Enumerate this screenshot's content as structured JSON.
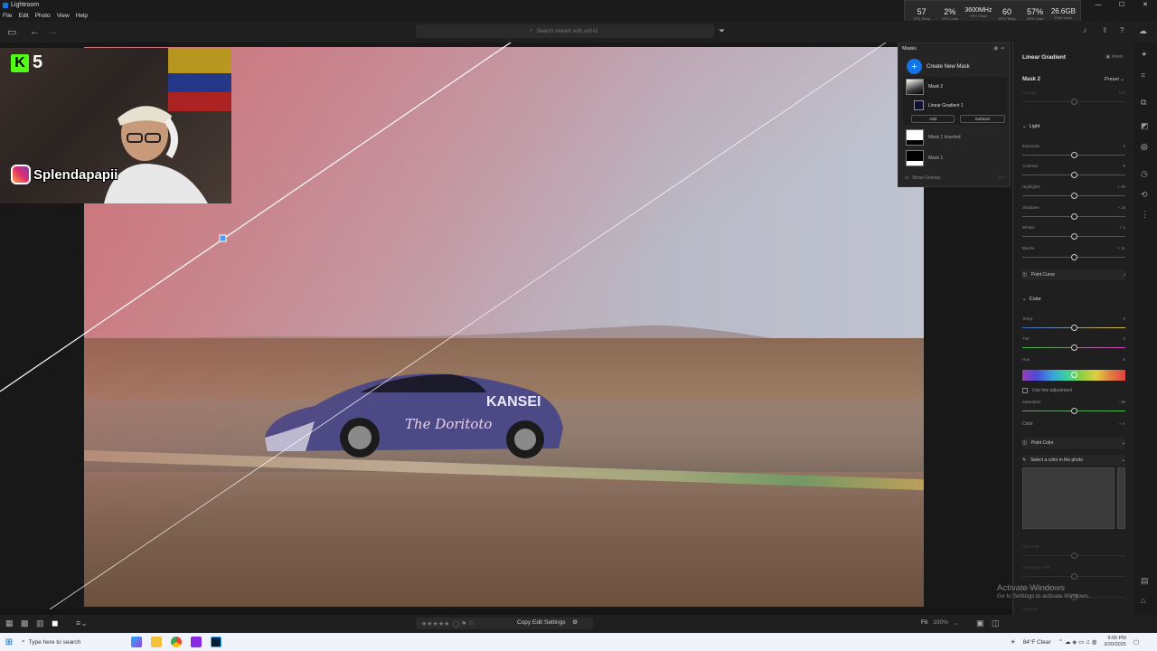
{
  "window": {
    "title": "Lightroom",
    "controls": [
      "—",
      "☐",
      "✕"
    ]
  },
  "menu": [
    "File",
    "Edit",
    "Photo",
    "View",
    "Help"
  ],
  "perf_overlay": [
    {
      "value": "57",
      "label": "CPU Temp"
    },
    {
      "value": "2%",
      "label": "CPU Load"
    },
    {
      "value": "3600MHz",
      "label": "CPU Clock"
    },
    {
      "value": "60",
      "label": "GPU Temp"
    },
    {
      "value": "57%",
      "label": "GPU Load"
    },
    {
      "value": "26.6GB",
      "label": "RAM Used"
    }
  ],
  "search": {
    "placeholder": "Search stream edit.ush#1"
  },
  "webcam": {
    "k_count": "5",
    "instagram": "Splendapapii"
  },
  "masks": {
    "title": "Masks",
    "create_label": "Create New Mask",
    "items": [
      {
        "name": "Mask 2"
      },
      {
        "name": "Linear Gradient 1"
      },
      {
        "name": "Mask 1 Inverted"
      },
      {
        "name": "Mask 1"
      }
    ],
    "add_label": "Add",
    "subtract_label": "Subtract",
    "show_overlay_label": "Show Overlay"
  },
  "right_panel": {
    "title": "Linear Gradient",
    "invert_label": "Invert",
    "mask_name": "Mask 2",
    "preset_label": "Preset",
    "amount_label": "Amount",
    "amount_value": "100",
    "light_section": "Light",
    "light_sliders": [
      {
        "label": "Exposure",
        "value": "0",
        "pos": 0.5
      },
      {
        "label": "Contrast",
        "value": "0",
        "pos": 0.5
      },
      {
        "label": "Highlights",
        "value": "+ 25",
        "pos": 0.5
      },
      {
        "label": "Shadows",
        "value": "+ 16",
        "pos": 0.5
      },
      {
        "label": "Whites",
        "value": "+ 1",
        "pos": 0.5
      },
      {
        "label": "Blacks",
        "value": "+ 11",
        "pos": 0.5
      }
    ],
    "point_curve_label": "Point Curve",
    "color_section": "Color",
    "color_sliders": [
      {
        "label": "Temp",
        "value": "0",
        "pos": 0.5
      },
      {
        "label": "Tint",
        "value": "0",
        "pos": 0.5
      },
      {
        "label": "Hue",
        "value": "0"
      }
    ],
    "fine_adjust_label": "Use fine adjustment",
    "saturation_label": "Saturation",
    "saturation_value": "- 49",
    "color_label": "Color",
    "point_color_label": "Point Color",
    "select_color_label": "Select a color in the photo",
    "faded_sliders": [
      "Hue Shift",
      "Saturation Shift",
      "Luminance Shift",
      "Variance"
    ]
  },
  "activate_windows": {
    "title": "Activate Windows",
    "subtitle": "Go to Settings to activate Windows."
  },
  "bottombar": {
    "copy_edit_label": "Copy Edit Settings",
    "fit_label": "Fit",
    "zoom_label": "100%"
  },
  "taskbar": {
    "search_placeholder": "Type here to search",
    "weather": "84°F  Clear",
    "time": "9:00 PM",
    "date": "3/20/2025"
  },
  "colors": {
    "accent": "#1473e6",
    "mask_overlay": "#d7505a",
    "kick_green": "#53fc18"
  }
}
